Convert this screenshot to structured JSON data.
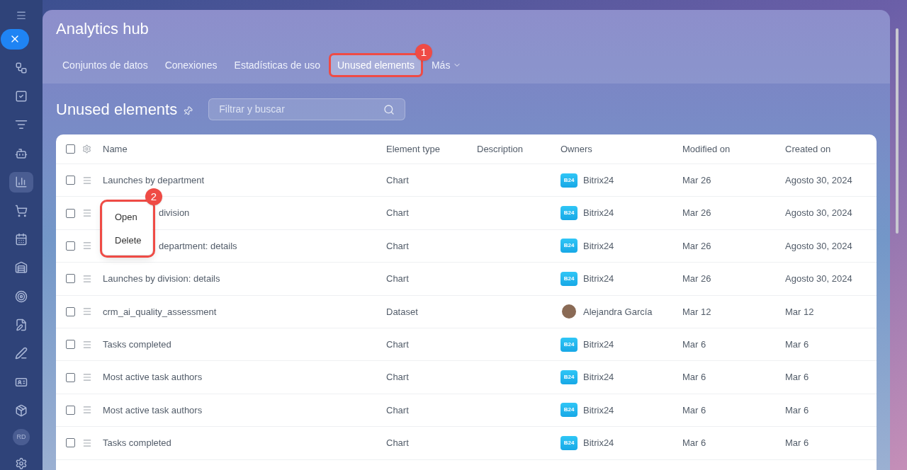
{
  "window": {
    "title": "Analytics hub"
  },
  "sidebar": {
    "items": [
      {
        "selected": false
      },
      {
        "selected": false
      },
      {
        "selected": false
      },
      {
        "selected": false
      },
      {
        "selected": false
      },
      {
        "selected": true
      },
      {
        "selected": false
      },
      {
        "selected": false
      },
      {
        "selected": false
      },
      {
        "selected": false
      },
      {
        "selected": false
      },
      {
        "selected": false
      },
      {
        "selected": false
      },
      {
        "selected": false
      }
    ],
    "avatar": "RD"
  },
  "tabs": [
    {
      "label": "Conjuntos de datos",
      "selected": false,
      "dropdown": false
    },
    {
      "label": "Conexiones",
      "selected": false,
      "dropdown": false
    },
    {
      "label": "Estadísticas de uso",
      "selected": false,
      "dropdown": false
    },
    {
      "label": "Unused elements",
      "selected": true,
      "dropdown": false,
      "callout": "1"
    },
    {
      "label": "Más",
      "selected": false,
      "dropdown": true
    }
  ],
  "page": {
    "title": "Unused elements",
    "search": {
      "placeholder": "Filtrar y buscar"
    }
  },
  "table": {
    "select_all_checked": false,
    "columns": [
      "Name",
      "Element type",
      "Description",
      "Owners",
      "Modified on",
      "Created on"
    ],
    "rows": [
      {
        "checked": false,
        "name": "Launches by department",
        "type": "Chart",
        "owner": {
          "kind": "app",
          "badge": "B24",
          "name": "Bitrix24"
        },
        "modified": "Mar 26",
        "created": "Agosto 30, 2024",
        "covered": false
      },
      {
        "checked": false,
        "name": "division",
        "type": "Chart",
        "owner": {
          "kind": "app",
          "badge": "B24",
          "name": "Bitrix24"
        },
        "modified": "Mar 26",
        "created": "Agosto 30, 2024",
        "covered": true
      },
      {
        "checked": false,
        "name": "department: details",
        "type": "Chart",
        "owner": {
          "kind": "app",
          "badge": "B24",
          "name": "Bitrix24"
        },
        "modified": "Mar 26",
        "created": "Agosto 30, 2024",
        "covered": true
      },
      {
        "checked": false,
        "name": "Launches by division: details",
        "type": "Chart",
        "owner": {
          "kind": "app",
          "badge": "B24",
          "name": "Bitrix24"
        },
        "modified": "Mar 26",
        "created": "Agosto 30, 2024",
        "covered": false
      },
      {
        "checked": false,
        "name": "crm_ai_quality_assessment",
        "type": "Dataset",
        "owner": {
          "kind": "person",
          "name": "Alejandra García"
        },
        "modified": "Mar 12",
        "created": "Mar 12",
        "covered": false
      },
      {
        "checked": false,
        "name": "Tasks completed",
        "type": "Chart",
        "owner": {
          "kind": "app",
          "badge": "B24",
          "name": "Bitrix24"
        },
        "modified": "Mar 6",
        "created": "Mar 6",
        "covered": false
      },
      {
        "checked": false,
        "name": "Most active task authors",
        "type": "Chart",
        "owner": {
          "kind": "app",
          "badge": "B24",
          "name": "Bitrix24"
        },
        "modified": "Mar 6",
        "created": "Mar 6",
        "covered": false
      },
      {
        "checked": false,
        "name": "Most active task authors",
        "type": "Chart",
        "owner": {
          "kind": "app",
          "badge": "B24",
          "name": "Bitrix24"
        },
        "modified": "Mar 6",
        "created": "Mar 6",
        "covered": false
      },
      {
        "checked": false,
        "name": "Tasks completed",
        "type": "Chart",
        "owner": {
          "kind": "app",
          "badge": "B24",
          "name": "Bitrix24"
        },
        "modified": "Mar 6",
        "created": "Mar 6",
        "covered": false
      }
    ]
  },
  "context_menu": {
    "items": [
      "Open",
      "Delete"
    ],
    "callout": "2"
  }
}
